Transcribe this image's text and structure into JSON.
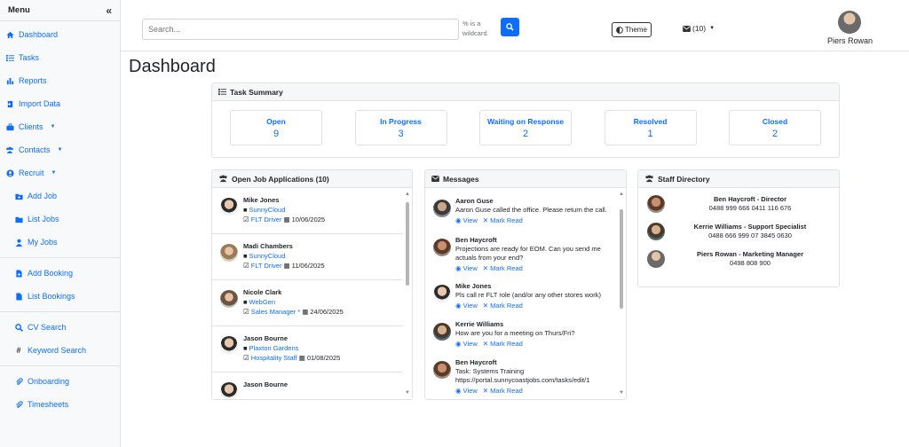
{
  "sidebar": {
    "title": "Menu",
    "collapse_icon": "«",
    "items": [
      {
        "label": "Dashboard",
        "icon": "home-icon"
      },
      {
        "label": "Tasks",
        "icon": "tasks-icon"
      },
      {
        "label": "Reports",
        "icon": "bar-chart-icon"
      },
      {
        "label": "Import Data",
        "icon": "import-icon"
      },
      {
        "label": "Clients",
        "icon": "briefcase-icon"
      },
      {
        "label": "Contacts",
        "icon": "users-icon"
      },
      {
        "label": "Recruit",
        "icon": "user-circle-icon"
      },
      {
        "label": "Add Job",
        "icon": "folder-plus-icon"
      },
      {
        "label": "List Jobs",
        "icon": "folder-icon"
      },
      {
        "label": "My Jobs",
        "icon": "user-icon"
      },
      {
        "label": "Add Booking",
        "icon": "file-plus-icon"
      },
      {
        "label": "List Bookings",
        "icon": "file-icon"
      },
      {
        "label": "CV Search",
        "icon": "search-icon"
      },
      {
        "label": "Keyword Search",
        "icon": "hash-icon"
      },
      {
        "label": "Onboarding",
        "icon": "paperclip-icon"
      },
      {
        "label": "Timesheets",
        "icon": "paperclip-icon"
      }
    ]
  },
  "header": {
    "search_placeholder": "Search...",
    "wildcard_hint": "% is a wildcard.",
    "theme_label": "Theme",
    "mail_count": "(10)",
    "user_name": "Piers Rowan"
  },
  "page_title": "Dashboard",
  "task_summary": {
    "title": "Task Summary",
    "stats": [
      {
        "label": "Open",
        "value": "9"
      },
      {
        "label": "In Progress",
        "value": "3"
      },
      {
        "label": "Waiting on Response",
        "value": "2"
      },
      {
        "label": "Resolved",
        "value": "1"
      },
      {
        "label": "Closed",
        "value": "2"
      }
    ]
  },
  "applications": {
    "title": "Open Job Applications (10)",
    "items": [
      {
        "name": "Mike Jones",
        "company": "SunnyCloud",
        "role": "FLT Driver",
        "date": "10/06/2025"
      },
      {
        "name": "Madi Chambers",
        "company": "SunnyCloud",
        "role": "FLT Driver",
        "date": "11/06/2025"
      },
      {
        "name": "Nicole Clark",
        "company": "WebGen",
        "role": "Sales Manager *",
        "date": "24/06/2025"
      },
      {
        "name": "Jason Bourne",
        "company": "Plaxton Gardens",
        "role": "Hospitality Staff",
        "date": "01/08/2025"
      },
      {
        "name": "Jason Bourne",
        "company": "",
        "role": "",
        "date": ""
      }
    ]
  },
  "messages": {
    "title": "Messages",
    "view_label": "View",
    "mark_label": "Mark Read",
    "items": [
      {
        "name": "Aaron Guse",
        "text": "Aaron Guse called the office. Please return the call."
      },
      {
        "name": "Ben Haycroft",
        "text": "Projections are ready for EOM. Can you send me actuals from your end?"
      },
      {
        "name": "Mike Jones",
        "text": "Pls call re FLT role (and/or any other stores work)"
      },
      {
        "name": "Kerrie Williams",
        "text": "How are you for a meeting on Thurs/Fri?"
      },
      {
        "name": "Ben Haycroft",
        "text": "Task: Systems Training https://portal.sunnycoastjobs.com/tasks/edit/1"
      }
    ]
  },
  "staff": {
    "title": "Staff Directory",
    "items": [
      {
        "name": "Ben Haycroft - Director",
        "phone": "0488 999 666 0411 116 676"
      },
      {
        "name": "Kerrie Williams - Support Specialist",
        "phone": "0488 666 999 07 3845 0630"
      },
      {
        "name": "Piers Rowan - Marketing Manager",
        "phone": "0498 808 900"
      }
    ]
  },
  "colors": {
    "accent": "#0d6efd",
    "border": "#dee2e6"
  }
}
